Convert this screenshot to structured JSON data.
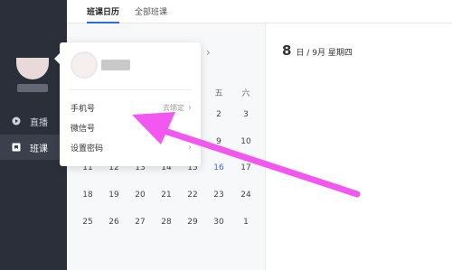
{
  "tabs": [
    {
      "label": "班课日历"
    },
    {
      "label": "全部班课"
    }
  ],
  "sidebar": {
    "items": [
      {
        "label": "直播",
        "icon": "live-icon"
      },
      {
        "label": "班课",
        "icon": "class-icon"
      }
    ]
  },
  "calendar": {
    "nav_icon": "chevron-right-icon",
    "weekday_headers": [
      "五",
      "六"
    ],
    "rows": [
      [
        "2",
        "3"
      ],
      [
        "9",
        "10"
      ],
      [
        "11",
        "12",
        "13",
        "14",
        "15",
        "16",
        "17"
      ],
      [
        "18",
        "19",
        "20",
        "21",
        "22",
        "23",
        "24"
      ],
      [
        "25",
        "26",
        "27",
        "28",
        "29",
        "30",
        "1"
      ]
    ],
    "selected_day": "16"
  },
  "date_panel": {
    "day": "8",
    "rest": "日 / 9月  星期四"
  },
  "popup": {
    "phone_label": "手机号",
    "phone_value": "去绑定",
    "wechat_label": "微信号",
    "password_label": "设置密码",
    "chevron": "›"
  },
  "colors": {
    "sidebar_bg": "#2b2f3a",
    "accent": "#2d6be3",
    "arrow": "#f257ef"
  }
}
